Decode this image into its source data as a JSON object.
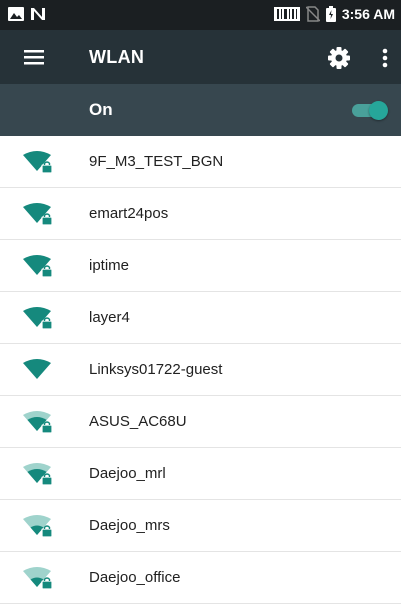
{
  "status_bar": {
    "time": "3:56 AM",
    "left_icons": [
      "image-notification-icon",
      "nfc-icon"
    ],
    "right_icons": [
      "barcode-icon",
      "no-sim-icon",
      "battery-icon"
    ]
  },
  "toolbar": {
    "title": "WLAN",
    "menu_icon": "menu-icon",
    "settings_icon": "gear-icon",
    "more_icon": "more-vert-icon"
  },
  "switch_bar": {
    "label": "On",
    "enabled": true
  },
  "colors": {
    "status_bar": "#1b1f22",
    "toolbar": "#263238",
    "switch_bar": "#37474f",
    "accent": "#26a69a",
    "wifi_strong": "#15897d",
    "wifi_weak": "#9fd3cc"
  },
  "networks": [
    {
      "ssid": "9F_M3_TEST_BGN",
      "signal_bars": 4,
      "locked": true
    },
    {
      "ssid": "emart24pos",
      "signal_bars": 4,
      "locked": true
    },
    {
      "ssid": "iptime",
      "signal_bars": 4,
      "locked": true
    },
    {
      "ssid": "layer4",
      "signal_bars": 4,
      "locked": true
    },
    {
      "ssid": "Linksys01722-guest",
      "signal_bars": 4,
      "locked": false
    },
    {
      "ssid": "ASUS_AC68U",
      "signal_bars": 3,
      "locked": true
    },
    {
      "ssid": "Daejoo_mrl",
      "signal_bars": 3,
      "locked": true
    },
    {
      "ssid": "Daejoo_mrs",
      "signal_bars": 2,
      "locked": true
    },
    {
      "ssid": "Daejoo_office",
      "signal_bars": 2,
      "locked": true
    }
  ]
}
